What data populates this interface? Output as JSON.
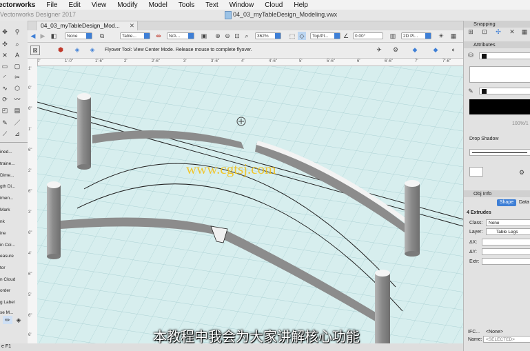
{
  "menubar": {
    "app": "ectorworks",
    "items": [
      "File",
      "Edit",
      "View",
      "Modify",
      "Model",
      "Tools",
      "Text",
      "Window",
      "Cloud",
      "Help"
    ]
  },
  "window": {
    "app_title": "Vectorworks Designer 2017",
    "doc_title": "04_03_myTableDesign_Modeling.vwx",
    "tab_label": "04_03_myTableDesign_Mod..."
  },
  "toolbar": {
    "class_value": "None",
    "layer_value": "Table...",
    "na_value": "N/A...",
    "zoom_value": "362%",
    "view_value": "Top/Pl...",
    "rotation_value": "0.00°",
    "render_value": "2D Pl..."
  },
  "mode_bar": {
    "message": "Flyover Tool: View Center Mode. Release mouse to complete flyover."
  },
  "ruler": {
    "h_ticks": [
      "0'",
      "1'-0\"",
      "1'-6\"",
      "2'",
      "2'-6\"",
      "3'",
      "3'-6\"",
      "4'",
      "4'-6\"",
      "5'",
      "5'-6\"",
      "6'",
      "6'-6\"",
      "7'",
      "7'-6\""
    ],
    "v_ticks": [
      "1'",
      "0'",
      "6\"",
      "1'",
      "6\"",
      "2'",
      "6\"",
      "3'",
      "6\"",
      "4'",
      "6\"",
      "5'",
      "6\"",
      "6'"
    ]
  },
  "tool_labels": [
    "ined...",
    "traine...",
    "Dime...",
    "gth Di...",
    "imen...",
    "Mark",
    "nk",
    "ine",
    "in Coi...",
    "easure",
    "tor",
    "n Cloud",
    "order",
    "g Label",
    "se M..."
  ],
  "snapping": {
    "title": "Snapping"
  },
  "attributes": {
    "title": "Attributes",
    "opacity": "100%/1",
    "drop_shadow": "Drop Shadow"
  },
  "obj_info": {
    "title": "Obj Info",
    "tab_shape": "Shape",
    "tab_data": "Data",
    "summary": "4 Extrudes",
    "class_label": "Class:",
    "class_value": "None",
    "layer_label": "Layer:",
    "layer_value": "Table Legs",
    "dx_label": "ΔX:",
    "dy_label": "ΔY:",
    "extr_label": "Extr:",
    "ifc_label": "IFC...",
    "ifc_value": "<None>",
    "name_label": "Name:",
    "name_placeholder": "<SELECTED>"
  },
  "status": {
    "text": "e F1"
  },
  "watermark": "www.cgtsj.com",
  "subtitle": "本教程中我会为大家讲解核心功能",
  "colors": {
    "accent": "#3e7fd6",
    "canvas": "#d7eeee",
    "grid": "#a9cfd2",
    "leg": "#8e8e8e"
  }
}
